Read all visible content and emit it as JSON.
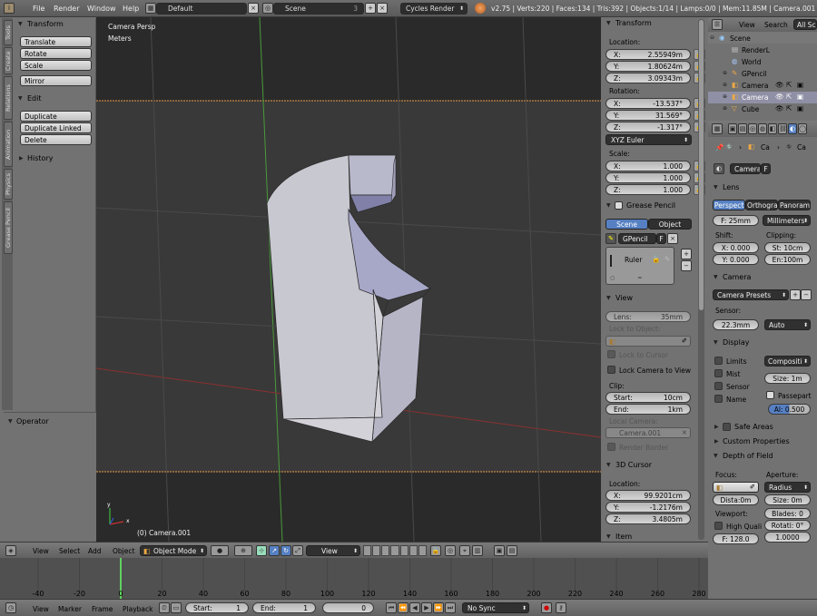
{
  "topbar": {
    "menus": [
      "File",
      "Render",
      "Window",
      "Help"
    ],
    "layout": "Default",
    "scene": "Scene",
    "scene_num": "3",
    "engine": "Cycles Render",
    "stats": "v2.75 | Verts:220 | Faces:134 | Tris:392 | Objects:1/14 | Lamps:0/0 | Mem:11.85M | Camera.001"
  },
  "sidetabs": [
    "Tools",
    "Create",
    "Relations",
    "Animation",
    "Physics",
    "Grease Pencil"
  ],
  "tools": {
    "transform_header": "Transform",
    "transform_buttons": [
      "Translate",
      "Rotate",
      "Scale"
    ],
    "mirror": "Mirror",
    "edit_header": "Edit",
    "edit_buttons": [
      "Duplicate",
      "Duplicate Linked",
      "Delete"
    ],
    "history": "History"
  },
  "operator": "Operator",
  "viewport": {
    "persp_label": "Camera Persp",
    "units_label": "Meters",
    "object_label": "(0) Camera.001",
    "axis_x": "x",
    "axis_y": "y"
  },
  "npanel": {
    "transform": "Transform",
    "location": "Location:",
    "loc": [
      {
        "l": "X:",
        "v": "2.55949m"
      },
      {
        "l": "Y:",
        "v": "1.80624m"
      },
      {
        "l": "Z:",
        "v": "3.09343m"
      }
    ],
    "rotation": "Rotation:",
    "rot": [
      {
        "l": "X:",
        "v": "-13.537°"
      },
      {
        "l": "Y:",
        "v": "31.569°"
      },
      {
        "l": "Z:",
        "v": "-1.317°"
      }
    ],
    "rot_mode": "XYZ Euler",
    "scale": "Scale:",
    "scl": [
      {
        "l": "X:",
        "v": "1.000"
      },
      {
        "l": "Y:",
        "v": "1.000"
      },
      {
        "l": "Z:",
        "v": "1.000"
      }
    ],
    "grease_pencil": "Grease Pencil",
    "gp_scene": "Scene",
    "gp_object": "Object",
    "gp_name": "GPencil",
    "gp_f": "F",
    "ruler": "Ruler",
    "view": "View",
    "lens_label": "Lens:",
    "lens_value": "35mm",
    "lock_to_object": "Lock to Object:",
    "lock_to_cursor": "Lock to Cursor",
    "lock_camera_to_view": "Lock Camera to View",
    "clip": "Clip:",
    "clip_start_l": "Start:",
    "clip_start_v": "10cm",
    "clip_end_l": "End:",
    "clip_end_v": "1km",
    "local_camera": "Local Camera:",
    "local_camera_value": "Camera.001",
    "render_border": "Render Border",
    "cursor": "3D Cursor",
    "cursor_location": "Location:",
    "cur": [
      {
        "l": "X:",
        "v": "99.9201cm"
      },
      {
        "l": "Y:",
        "v": "-1.2176m"
      },
      {
        "l": "Z:",
        "v": "3.4805m"
      }
    ],
    "item": "Item"
  },
  "outliner": {
    "view": "View",
    "search": "Search",
    "all_scenes": "All Sc",
    "items": [
      "Scene",
      "RenderL",
      "World",
      "GPencil",
      "Camera",
      "Camera",
      "Cube"
    ]
  },
  "props": {
    "crumb_ca1": "Ca",
    "crumb_ca2": "Ca",
    "data_name": "Camera",
    "data_f": "F",
    "lens": "Lens",
    "lens_types": [
      "Perspectiv",
      "Orthograp",
      "Panoramic"
    ],
    "focal": "F: 25mm",
    "lens_unit": "Millimeters",
    "shift": "Shift:",
    "clipping": "Clipping:",
    "shift_x": "X: 0.000",
    "shift_y": "Y: 0.000",
    "clip_st": "St: 10cm",
    "clip_en": "En:100m",
    "camera": "Camera",
    "camera_presets": "Camera Presets",
    "sensor": "Sensor:",
    "sensor_size": "22.3mm",
    "sensor_fit": "Auto",
    "display": "Display",
    "limits": "Limits",
    "mist": "Mist",
    "sensor_chk": "Sensor",
    "name_chk": "Name",
    "composition": "Compositi",
    "size": "Size: 1m",
    "passepartout": "Passepart",
    "alpha": "Al: 0.500",
    "safe_areas": "Safe Areas",
    "custom_properties": "Custom Properties",
    "dof": "Depth of Field",
    "focus": "Focus:",
    "aperture": "Aperture:",
    "radius": "Radius",
    "distance": "Dista:0m",
    "size_0": "Size:  0m",
    "viewport": "Viewport:",
    "blades": "Blades: 0",
    "high_quality": "High Quali",
    "rotation": "Rotati: 0°",
    "fstop": "F: 128.0",
    "ratio": "1.0000"
  },
  "view3d_header": {
    "menus": [
      "View",
      "Select",
      "Add",
      "Object"
    ],
    "mode": "Object Mode"
  },
  "timeline": {
    "ticks": [
      "-40",
      "-20",
      "0",
      "20",
      "40",
      "60",
      "80",
      "100",
      "120",
      "140",
      "160",
      "180",
      "200",
      "220",
      "240",
      "260",
      "280"
    ]
  },
  "timeline_header": {
    "menus": [
      "View",
      "Marker",
      "Frame",
      "Playback"
    ],
    "start_label": "Start:",
    "start": "1",
    "end_label": "End:",
    "end": "1",
    "current": "0",
    "sync": "No Sync",
    "view": "View"
  },
  "colors": {
    "accent": "#5680c2",
    "viewport_bg": "#393939",
    "panel": "#727272",
    "frame_marker": "#60d060",
    "object": "#c8c8d0",
    "object_shadow": "#9a9ab8"
  }
}
